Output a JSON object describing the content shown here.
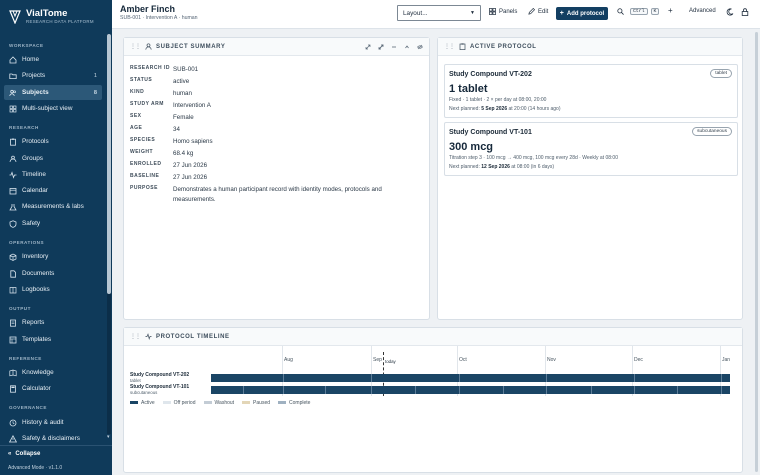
{
  "app": {
    "name": "VialTome",
    "tagline": "RESEARCH DATA PLATFORM",
    "version": "Advanced Mode · v1.1.0",
    "collapse_label": "Collapse"
  },
  "sidebar": {
    "sections": [
      {
        "label": "WORKSPACE",
        "items": [
          {
            "label": "Home",
            "icon": "home-icon"
          },
          {
            "label": "Projects",
            "icon": "folder-icon",
            "badge": "1"
          },
          {
            "label": "Subjects",
            "icon": "users-icon",
            "badge": "8",
            "active": true
          },
          {
            "label": "Multi-subject view",
            "icon": "grid-icon"
          }
        ]
      },
      {
        "label": "RESEARCH",
        "items": [
          {
            "label": "Protocols",
            "icon": "clipboard-icon"
          },
          {
            "label": "Groups",
            "icon": "group-icon"
          },
          {
            "label": "Timeline",
            "icon": "timeline-icon"
          },
          {
            "label": "Calendar",
            "icon": "calendar-icon"
          },
          {
            "label": "Measurements & labs",
            "icon": "flask-icon"
          },
          {
            "label": "Safety",
            "icon": "shield-icon"
          }
        ]
      },
      {
        "label": "OPERATIONS",
        "items": [
          {
            "label": "Inventory",
            "icon": "box-icon"
          },
          {
            "label": "Documents",
            "icon": "document-icon"
          },
          {
            "label": "Logbooks",
            "icon": "book-icon"
          }
        ]
      },
      {
        "label": "OUTPUT",
        "items": [
          {
            "label": "Reports",
            "icon": "report-icon"
          },
          {
            "label": "Templates",
            "icon": "template-icon"
          }
        ]
      },
      {
        "label": "REFERENCE",
        "items": [
          {
            "label": "Knowledge",
            "icon": "knowledge-icon"
          },
          {
            "label": "Calculator",
            "icon": "calculator-icon"
          }
        ]
      },
      {
        "label": "GOVERNANCE",
        "items": [
          {
            "label": "History & audit",
            "icon": "history-icon"
          },
          {
            "label": "Safety & disclaimers",
            "icon": "warning-icon"
          }
        ]
      }
    ]
  },
  "header": {
    "title": "Amber Finch",
    "subtitle": "SUB-001 · Intervention A · human",
    "layout_placeholder": "Layout...",
    "panels_label": "Panels",
    "edit_label": "Edit",
    "add_protocol_label": "Add protocol",
    "shortcut_ctrl": "Ctrl",
    "shortcut_key": "K",
    "advanced_label": "Advanced"
  },
  "summary": {
    "title": "SUBJECT SUMMARY",
    "fields": [
      {
        "key": "RESEARCH ID",
        "value": "SUB-001"
      },
      {
        "key": "STATUS",
        "value": "active"
      },
      {
        "key": "KIND",
        "value": "human"
      },
      {
        "key": "STUDY ARM",
        "value": "Intervention A"
      },
      {
        "key": "SEX",
        "value": "Female"
      },
      {
        "key": "AGE",
        "value": "34"
      },
      {
        "key": "SPECIES",
        "value": "Homo sapiens"
      },
      {
        "key": "WEIGHT",
        "value": "68.4 kg"
      },
      {
        "key": "ENROLLED",
        "value": "27 Jun 2026"
      },
      {
        "key": "BASELINE",
        "value": "27 Jun 2026"
      },
      {
        "key": "PURPOSE",
        "value": "Demonstrates a human participant record with identity modes, protocols and measurements."
      }
    ]
  },
  "active_protocol": {
    "title": "ACTIVE PROTOCOL",
    "cards": [
      {
        "name": "Study Compound VT-202",
        "tag": "tablet",
        "dose": "1 tablet",
        "schedule": "Fixed · 1 tablet · 2 × per day at 08:00, 20:00",
        "next_prefix": "Next planned:",
        "next_date": "5 Sep 2026",
        "next_suffix": "at 20:00 (14 hours ago)"
      },
      {
        "name": "Study Compound VT-101",
        "tag": "subcutaneous",
        "dose": "300 mcg",
        "schedule": "Titration step 3 · 100 mcg → 400 mcg, 100 mcg every 28d · Weekly at 08:00",
        "next_prefix": "Next planned:",
        "next_date": "12 Sep 2026",
        "next_suffix": "at 08:00 (in 6 days)"
      }
    ]
  },
  "timeline": {
    "title": "PROTOCOL TIMELINE",
    "months": [
      "Aug",
      "Sep",
      "Oct",
      "Nov",
      "Dec",
      "Jan"
    ],
    "today_label": "today",
    "rows": [
      {
        "name": "Study Compound VT-202",
        "route": "tablet",
        "status": "Active"
      },
      {
        "name": "Study Compound VT-101",
        "route": "subcutaneous",
        "status": "Active"
      }
    ],
    "legend": [
      {
        "label": "Active",
        "color": "#1a4565"
      },
      {
        "label": "Off period",
        "color": "#dfe6ec"
      },
      {
        "label": "Washout",
        "color": "#c3ccd5"
      },
      {
        "label": "Paused",
        "color": "#e3d6b7"
      },
      {
        "label": "Complete",
        "color": "#9fb1c1"
      }
    ]
  }
}
